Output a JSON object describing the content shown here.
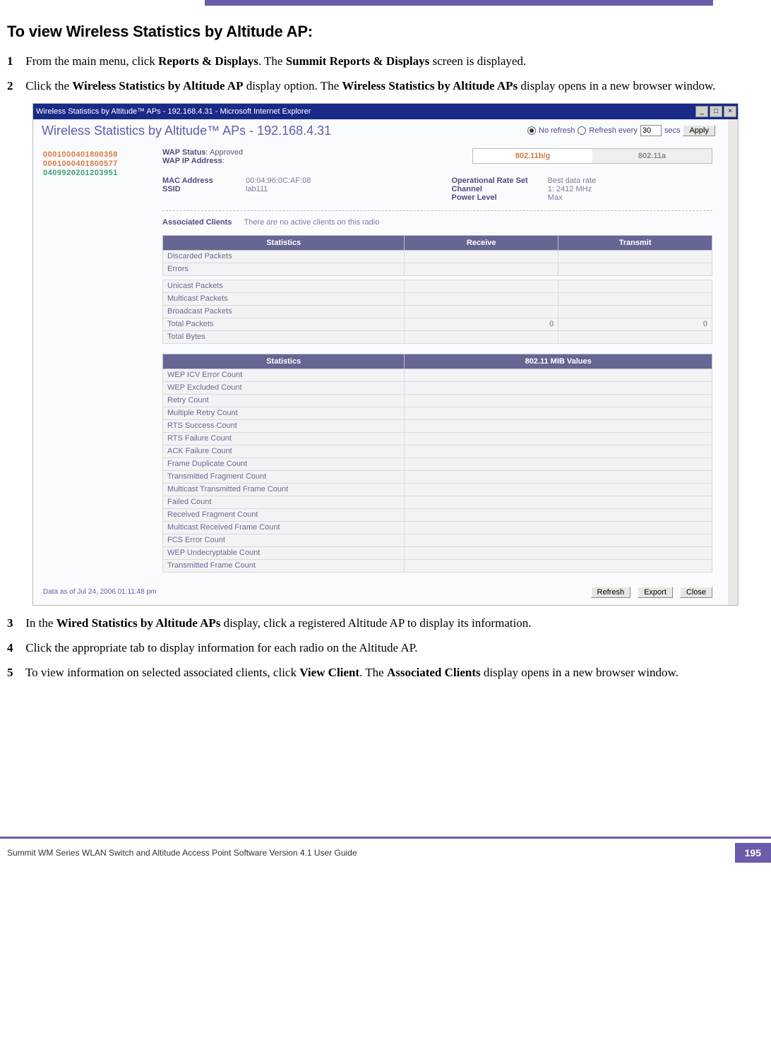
{
  "doc": {
    "section_title": "To view Wireless Statistics by Altitude AP:",
    "steps": {
      "s1_num": "1",
      "s1_a": "From the main menu, click ",
      "s1_b1": "Reports & Displays",
      "s1_c": ". The ",
      "s1_b2": "Summit Reports & Displays",
      "s1_d": " screen is displayed.",
      "s2_num": "2",
      "s2_a": "Click the ",
      "s2_b1": "Wireless Statistics by Altitude AP",
      "s2_c": " display option. The ",
      "s2_b2": "Wireless Statistics by Altitude APs",
      "s2_d": " display opens in a new browser window.",
      "s3_num": "3",
      "s3_a": "In the ",
      "s3_b1": "Wired Statistics by Altitude APs",
      "s3_c": " display, click a registered Altitude AP to display its information.",
      "s4_num": "4",
      "s4_a": "Click the appropriate tab to display information for each radio on the Altitude AP.",
      "s5_num": "5",
      "s5_a": "To view information on selected associated clients, click ",
      "s5_b1": "View Client",
      "s5_c": ". The ",
      "s5_b2": "Associated Clients",
      "s5_d": " display opens in a new browser window."
    },
    "footer_text": "Summit WM Series WLAN Switch and Altitude Access Point Software Version 4.1 User Guide",
    "page_number": "195"
  },
  "win": {
    "title": "Wireless Statistics by Altitude™ APs - 192.168.4.31 - Microsoft Internet Explorer",
    "content_title": "Wireless Statistics by Altitude™ APs - 192.168.4.31",
    "refresh": {
      "no_refresh": "No refresh",
      "refresh_every": "Refresh every",
      "secs": "secs",
      "value": "30",
      "apply": "Apply"
    },
    "aps": [
      "0001000401800358",
      "0001000401800577",
      "0409920201203951"
    ],
    "wap": {
      "status_label": "WAP Status",
      "status_value": ": Approved",
      "ip_label": "WAP IP Address",
      "ip_value": ":"
    },
    "tabs": {
      "active": "802.11b/g",
      "inactive": "802.11a"
    },
    "radio": {
      "mac_label": "MAC Address",
      "mac_value": "00:04:96:0C:AF:08",
      "ssid_label": "SSID",
      "ssid_value": "lab111",
      "oprate_label": "Operational Rate Set",
      "oprate_value": "Best data rate",
      "channel_label": "Channel",
      "channel_value": "1: 2412 MHz",
      "power_label": "Power Level",
      "power_value": "Max"
    },
    "assoc": {
      "label": "Associated Clients",
      "msg": "There are no active clients on this radio"
    },
    "table1": {
      "h1": "Statistics",
      "h2": "Receive",
      "h3": "Transmit",
      "rows1": [
        "Discarded Packets",
        "Errors"
      ],
      "rows2": [
        "Unicast Packets",
        "Multicast Packets",
        "Broadcast Packets",
        "Total Packets",
        "Total Bytes"
      ],
      "totalpackets_rx": "0",
      "totalpackets_tx": "0"
    },
    "table2": {
      "h1": "Statistics",
      "h2": "802.11 MIB Values",
      "rows": [
        "WEP ICV Error Count",
        "WEP Excluded Count",
        "Retry Count",
        "Multiple Retry Count",
        "RTS Success Count",
        "RTS Failure Count",
        "ACK Failure Count",
        "Frame Duplicate Count",
        "Transmitted Fragment Count",
        "Multicast Transmitted Frame Count",
        "Failed Count",
        "Received Fragment Count",
        "Multicast Received Frame Count",
        "FCS Error Count",
        "WEP Undecryptable Count",
        "Transmitted Frame Count"
      ]
    },
    "footer": {
      "timestamp": "Data as of Jul 24, 2006 01:11:48 pm",
      "refresh": "Refresh",
      "export": "Export",
      "close": "Close"
    }
  }
}
